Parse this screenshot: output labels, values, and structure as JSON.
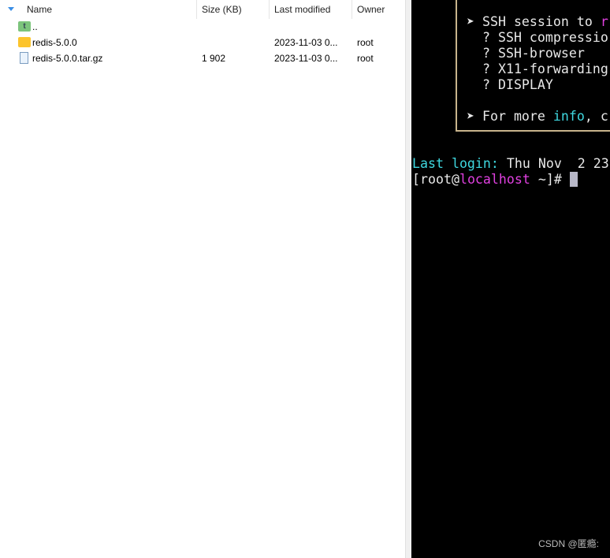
{
  "file_list": {
    "columns": [
      "Name",
      "Size (KB)",
      "Last modified",
      "Owner"
    ],
    "rows": [
      {
        "name": "..",
        "size": "",
        "modified": "",
        "owner": "",
        "icon": "parent-folder-icon"
      },
      {
        "name": "redis-5.0.0",
        "size": "",
        "modified": "2023-11-03 0...",
        "owner": "root",
        "icon": "folder-icon"
      },
      {
        "name": "redis-5.0.0.tar.gz",
        "size": "1 902",
        "modified": "2023-11-03 0...",
        "owner": "root",
        "icon": "archive-file-icon"
      }
    ]
  },
  "terminal": {
    "l1a": "➤ SSH session to ",
    "l1b": "r",
    "l2": "  ? SSH compressio",
    "l3": "  ? SSH-browser",
    "l4": "  ? X11-forwarding",
    "l5": "  ? DISPLAY",
    "l6a": "➤ For more ",
    "l6b": "info",
    ", ": "",
    "l6c": ", c",
    "login_label": "Last login:",
    "login_text": " Thu Nov  2 23",
    "prompt_a": "[root@",
    "prompt_host": "localhost",
    "prompt_b": " ~]# "
  },
  "watermark": "CSDN @匿瘾:",
  "colors": {
    "cyan": "#3fd8e0",
    "magenta": "#e040e0",
    "border": "#c8b48c"
  }
}
